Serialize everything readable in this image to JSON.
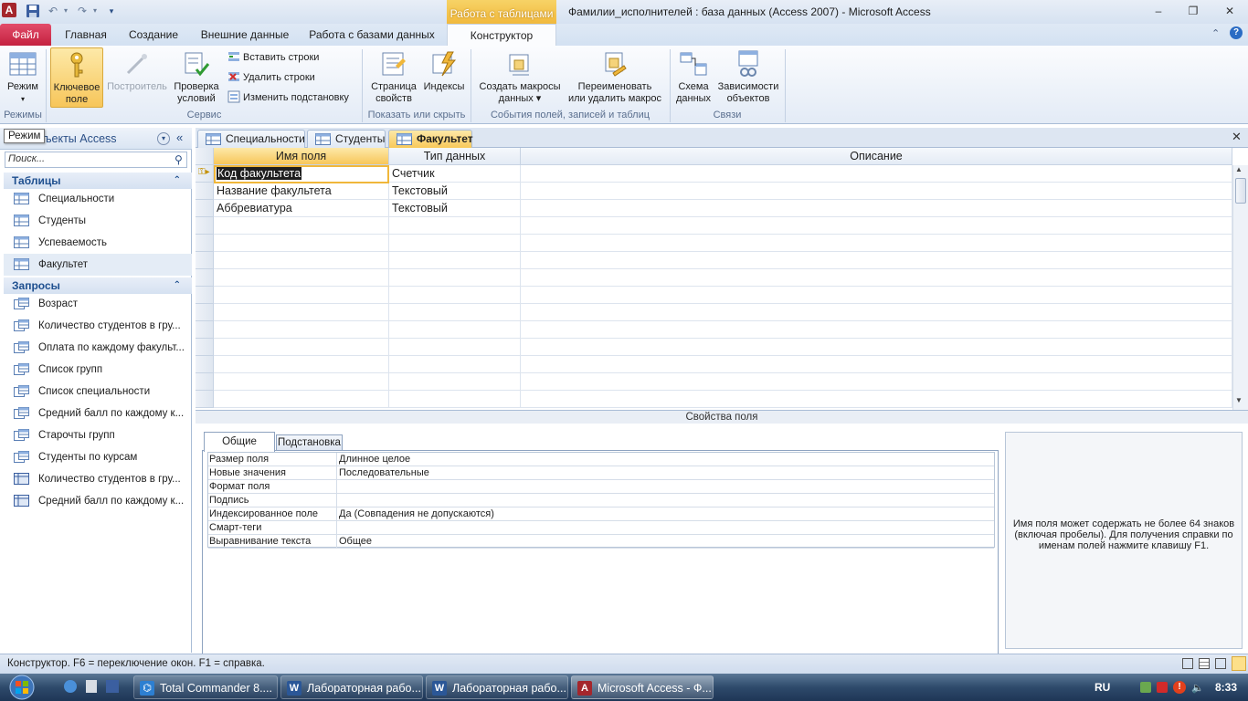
{
  "window": {
    "context_tab": "Работа с таблицами",
    "title": "Фамилии_исполнителей : база данных (Access 2007)  -  Microsoft Access"
  },
  "ribbon": {
    "tabs": [
      "Файл",
      "Главная",
      "Создание",
      "Внешние данные",
      "Работа с базами данных",
      "Конструктор"
    ],
    "groups": {
      "modes": {
        "label": "Режимы",
        "view_btn": "Режим"
      },
      "service": {
        "label": "Сервис",
        "primary_key": [
          "Ключевое",
          "поле"
        ],
        "builder": "Построитель",
        "test_rules": [
          "Проверка",
          "условий"
        ],
        "insert_rows": "Вставить строки",
        "delete_rows": "Удалить строки",
        "modify_lookup": "Изменить подстановку"
      },
      "show_hide": {
        "label": "Показать или скрыть",
        "property_sheet": [
          "Страница",
          "свойств"
        ],
        "indexes": "Индексы"
      },
      "events": {
        "label": "События полей, записей и таблиц",
        "create_macros": [
          "Создать макросы",
          "данных ▾"
        ],
        "rename_macro": [
          "Переименовать",
          "или удалить макрос"
        ]
      },
      "relations": {
        "label": "Связи",
        "schema": [
          "Схема",
          "данных"
        ],
        "dependencies": [
          "Зависимости",
          "объектов"
        ]
      }
    }
  },
  "nav": {
    "title": "Все объекты Access",
    "tooltip": "Режим",
    "search_placeholder": "Поиск...",
    "tables_header": "Таблицы",
    "tables": [
      "Специальности",
      "Студенты",
      "Успеваемость",
      "Факультет"
    ],
    "queries_header": "Запросы",
    "queries": [
      "Возраст",
      "Количество студентов в гру...",
      "Оплата по каждому факульт...",
      "Список групп",
      "Список специальности",
      "Средний балл по каждому к...",
      "Старочты групп",
      "Студенты по курсам",
      "Количество студентов в гру...",
      "Средний балл по каждому к..."
    ]
  },
  "doc_tabs": [
    "Специальности",
    "Студенты",
    "Факультет"
  ],
  "grid": {
    "headers": [
      "Имя поля",
      "Тип данных",
      "Описание"
    ],
    "rows": [
      {
        "name": "Код факультета",
        "type": "Счетчик",
        "desc": ""
      },
      {
        "name": "Название факультета",
        "type": "Текстовый",
        "desc": ""
      },
      {
        "name": "Аббревиатура",
        "type": "Текстовый",
        "desc": ""
      }
    ]
  },
  "properties": {
    "title": "Свойства поля",
    "tabs": [
      "Общие",
      "Подстановка"
    ],
    "rows": [
      {
        "name": "Размер поля",
        "value": "Длинное целое"
      },
      {
        "name": "Новые значения",
        "value": "Последовательные"
      },
      {
        "name": "Формат поля",
        "value": ""
      },
      {
        "name": "Подпись",
        "value": ""
      },
      {
        "name": "Индексированное поле",
        "value": "Да (Совпадения не допускаются)"
      },
      {
        "name": "Смарт-теги",
        "value": ""
      },
      {
        "name": "Выравнивание текста",
        "value": "Общее"
      }
    ],
    "help": "Имя поля может содержать не более 64 знаков (включая пробелы). Для получения справки по именам полей нажмите клавишу F1."
  },
  "status": {
    "text": "Конструктор.  F6 = переключение окон.  F1 = справка."
  },
  "taskbar": {
    "items": [
      "Total Commander 8....",
      "Лабораторная рабо...",
      "Лабораторная рабо...",
      "Microsoft Access - Ф..."
    ],
    "lang": "RU",
    "clock": "8:33"
  }
}
